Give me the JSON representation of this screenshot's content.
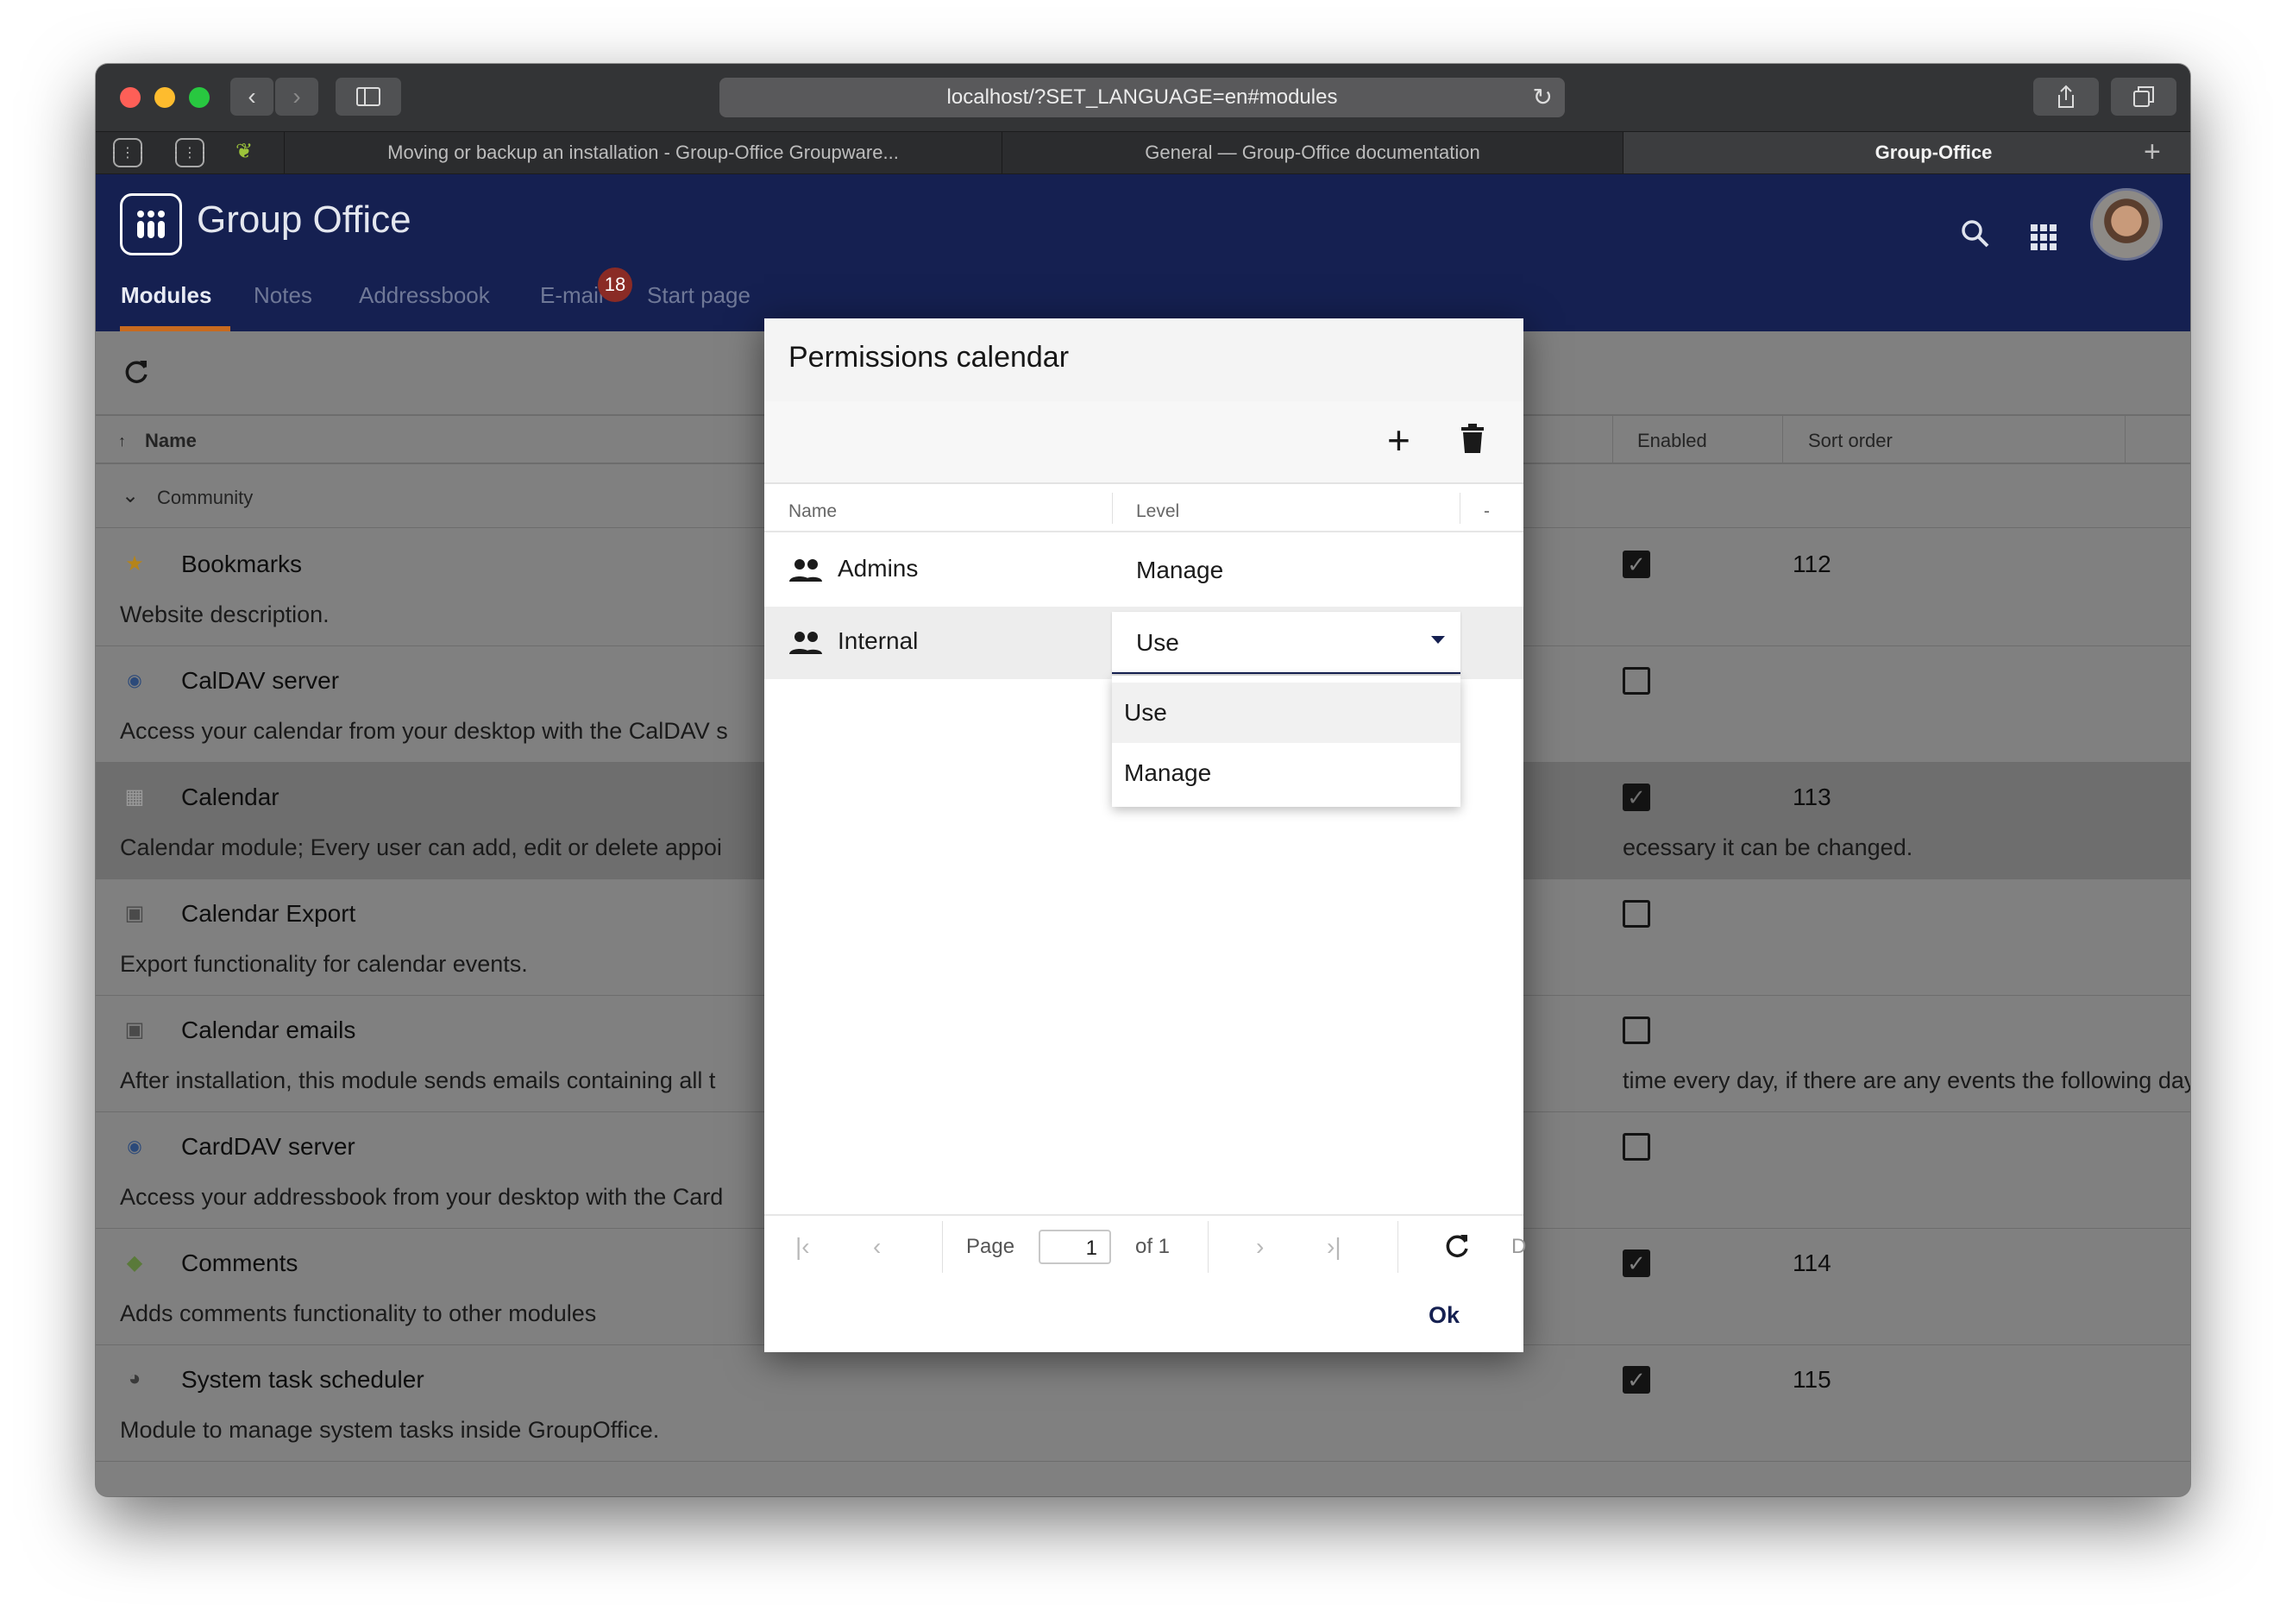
{
  "browser": {
    "url": "localhost/?SET_LANGUAGE=en#modules",
    "tabs": [
      {
        "title": "Moving or backup an installation - Group-Office Groupware..."
      },
      {
        "title": "General — Group-Office documentation"
      },
      {
        "title": "Group-Office"
      }
    ],
    "new_tab_label": "+"
  },
  "app": {
    "title": "Group Office",
    "nav": [
      {
        "label": "Modules"
      },
      {
        "label": "Notes"
      },
      {
        "label": "Addressbook"
      },
      {
        "label": "E-mail"
      },
      {
        "label": "Start page"
      }
    ],
    "email_badge": "18"
  },
  "modules_grid": {
    "columns": {
      "name": "Name",
      "enabled": "Enabled",
      "sort_order": "Sort order"
    },
    "group_label": "Community",
    "rows": [
      {
        "name": "Bookmarks",
        "description": "Website description.",
        "enabled": true,
        "sort_order": "112",
        "icon": "star-icon"
      },
      {
        "name": "CalDAV server",
        "description": "Access your calendar from your desktop with the CalDAV s",
        "enabled": false,
        "sort_order": "",
        "icon": "caldav-icon"
      },
      {
        "name": "Calendar",
        "description": "Calendar module; Every user can add, edit or delete appoi",
        "description_right": "ecessary it can be changed.",
        "enabled": true,
        "sort_order": "113",
        "icon": "calendar-icon"
      },
      {
        "name": "Calendar Export",
        "description": "Export functionality for calendar events.",
        "enabled": false,
        "sort_order": "",
        "icon": "module-icon"
      },
      {
        "name": "Calendar emails",
        "description": "After installation, this module sends emails containing all t",
        "description_right": "time every day, if there are any events the following day.",
        "enabled": false,
        "sort_order": "",
        "icon": "module-icon"
      },
      {
        "name": "CardDAV server",
        "description": "Access your addressbook from your desktop with the Card",
        "enabled": false,
        "sort_order": "",
        "icon": "carddav-icon"
      },
      {
        "name": "Comments",
        "description": "Adds comments functionality to other modules",
        "enabled": true,
        "sort_order": "114",
        "icon": "comments-icon"
      },
      {
        "name": "System task scheduler",
        "description": "Module to manage system tasks inside GroupOffice.",
        "enabled": true,
        "sort_order": "115",
        "icon": "scheduler-icon"
      }
    ]
  },
  "dialog": {
    "title": "Permissions calendar",
    "columns": {
      "name": "Name",
      "level": "Level",
      "extra": "-"
    },
    "rows": [
      {
        "name": "Admins",
        "level": "Manage"
      },
      {
        "name": "Internal",
        "level": "Use"
      }
    ],
    "combo_value": "Use",
    "options": [
      "Use",
      "Manage"
    ],
    "pager": {
      "page_label": "Page",
      "page_value": "1",
      "of_label": "of 1",
      "extra": "D"
    },
    "ok_label": "Ok"
  },
  "colors": {
    "header_bg": "#152051",
    "accent": "#c86a1f",
    "badge": "#8a2b25"
  }
}
